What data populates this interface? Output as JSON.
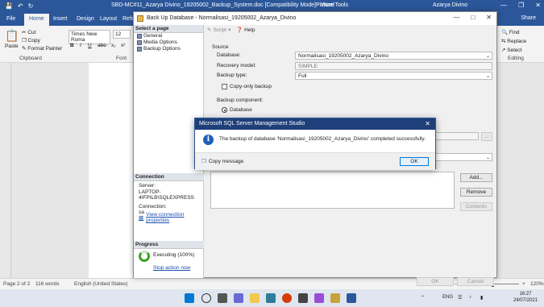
{
  "word": {
    "file_tab": "File",
    "title": "SBD-MC#11_Azarya Divino_19205002_Backup_System.doc [Compatibility Mode] - Word",
    "picture_tools": "Picture Tools",
    "user": "Azarya Divino",
    "tabs": [
      "Home",
      "Insert",
      "Design",
      "Layout",
      "Refe"
    ],
    "share": "Share",
    "ribbon": {
      "paste": "Paste",
      "cut": "Cut",
      "copy": "Copy",
      "format_painter": "Format Painter",
      "clipboard": "Clipboard",
      "font_name": "Times New Roma",
      "font_size": "12",
      "font_group": "Font",
      "find": "Find",
      "replace": "Replace",
      "select": "Select",
      "editing": "Editing"
    },
    "status": {
      "page": "Page 2 of 2",
      "words": "116 words",
      "language": "English (United States)",
      "zoom": "120%"
    }
  },
  "taskbar": {
    "lang": "ENG",
    "time": "16:27",
    "date": "24/07/2021"
  },
  "ssms": {
    "title": "Back Up Database - Normalisasi_19205002_Azarya_Divino",
    "select_page": "Select a page",
    "pages": [
      "General",
      "Media Options",
      "Backup Options"
    ],
    "toolbar": {
      "script": "Script",
      "help": "Help"
    },
    "source_label": "Source",
    "database_label": "Database:",
    "database_value": "Normalisasi_19205002_Azarya_Divino",
    "recovery_label": "Recovery model:",
    "recovery_value": "SIMPLE",
    "backup_type_label": "Backup type:",
    "backup_type_value": "Full",
    "copy_only": "Copy-only backup",
    "backup_component": "Backup component:",
    "component_database": "Database",
    "connection_head": "Connection",
    "server_label": "Server:",
    "server_value": "LAPTOP-4IFPILB\\SQLEXPRESS",
    "connection_label": "Connection:",
    "connection_value": "sa",
    "view_conn": "View connection properties",
    "progress_head": "Progress",
    "executing": "Executing (100%)",
    "stop_action": "Stop action now",
    "add_btn": "Add...",
    "remove_btn": "Remove",
    "contents_btn": "Contents",
    "ok_btn": "OK",
    "cancel_btn": "Cancel"
  },
  "msgbox": {
    "title": "Microsoft SQL Server Management Studio",
    "text": "The backup of database 'Normalisasi_19205002_Azarya_Divino' completed successfully.",
    "copy_message": "Copy message",
    "ok": "OK"
  }
}
